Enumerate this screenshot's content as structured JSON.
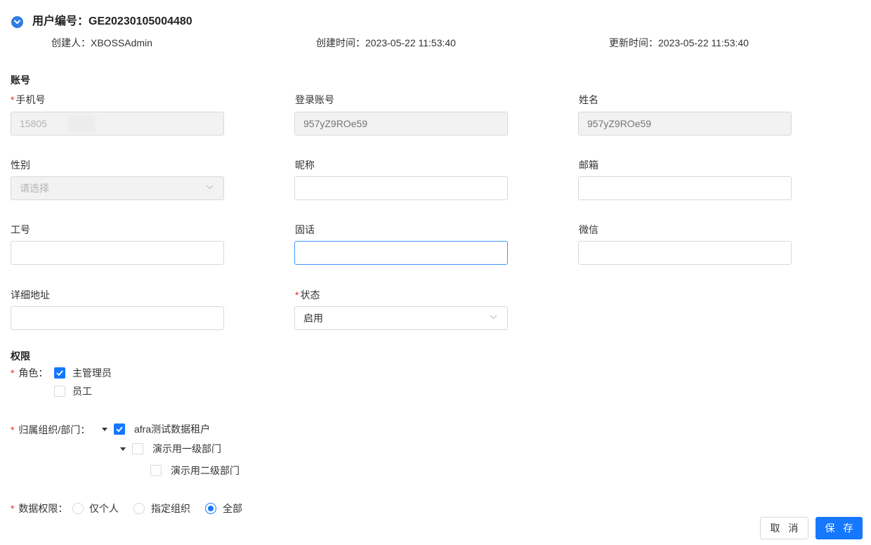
{
  "header": {
    "title": "用户编号：GE20230105004480",
    "creator": "创建人：XBOSSAdmin",
    "created_time": "创建时间：2023-05-22 11:53:40",
    "updated_time": "更新时间：2023-05-22 11:53:40"
  },
  "account": {
    "section_title": "账号",
    "phone": {
      "label": "手机号",
      "value": "15805",
      "value_tail": "5"
    },
    "login": {
      "label": "登录账号",
      "placeholder": "957yZ9ROe59"
    },
    "name": {
      "label": "姓名",
      "placeholder": "957yZ9ROe59"
    },
    "gender": {
      "label": "性别",
      "placeholder": "请选择"
    },
    "nickname": {
      "label": "昵称",
      "value": ""
    },
    "email": {
      "label": "邮箱",
      "value": ""
    },
    "employee_id": {
      "label": "工号",
      "value": ""
    },
    "landline": {
      "label": "固话",
      "value": ""
    },
    "wechat": {
      "label": "微信",
      "value": ""
    },
    "address": {
      "label": "详细地址",
      "value": ""
    },
    "status": {
      "label": "状态",
      "value": "启用"
    }
  },
  "permission": {
    "section_title": "权限",
    "role_label": "角色：",
    "roles": [
      {
        "label": "主管理员",
        "checked": true
      },
      {
        "label": "员工",
        "checked": false
      }
    ],
    "org_label": "归属组织/部门：",
    "orgs": [
      {
        "label": "afra测试数据租户",
        "checked": true
      },
      {
        "label": "演示用一级部门",
        "checked": false
      },
      {
        "label": "演示用二级部门",
        "checked": false
      }
    ],
    "data_label": "数据权限：",
    "data_options": [
      {
        "label": "仅个人",
        "checked": false
      },
      {
        "label": "指定组织",
        "checked": false
      },
      {
        "label": "全部",
        "checked": true
      }
    ]
  },
  "actions": {
    "cancel": "取 消",
    "save": "保 存"
  },
  "colors": {
    "primary": "#1677ff",
    "required": "#f5222d",
    "disabled_bg": "#f2f2f2",
    "focus_border": "#4096ff"
  }
}
